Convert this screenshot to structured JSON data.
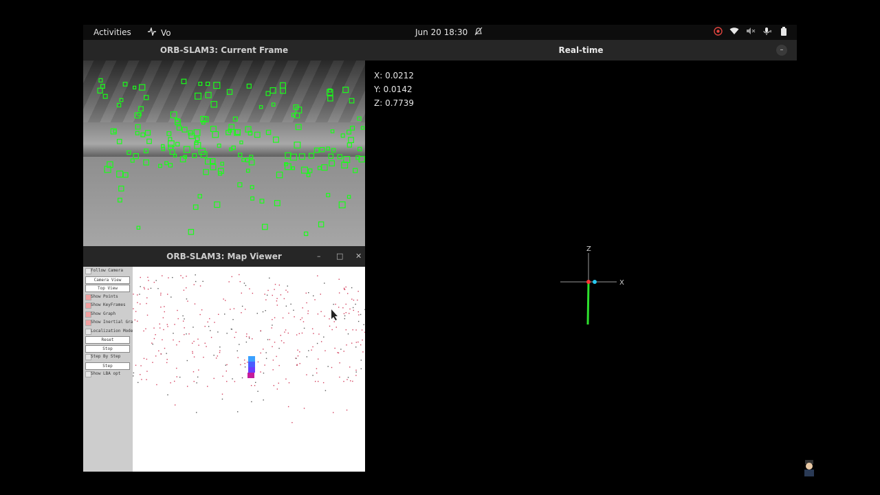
{
  "topbar": {
    "activities": "Activities",
    "app_name": "Vo",
    "clock": "Jun 20  18:30"
  },
  "current_frame": {
    "title": "ORB-SLAM3: Current Frame"
  },
  "map_viewer": {
    "title": "ORB-SLAM3: Map Viewer",
    "minimize": "–",
    "maximize": "□",
    "close": "✕",
    "panel": [
      {
        "type": "check",
        "label": "Follow Camera",
        "checked": false
      },
      {
        "type": "button",
        "label": "Camera View"
      },
      {
        "type": "button",
        "label": "Top View"
      },
      {
        "type": "check",
        "label": "Show Points",
        "checked": true
      },
      {
        "type": "check",
        "label": "Show KeyFrames",
        "checked": true
      },
      {
        "type": "check",
        "label": "Show Graph",
        "checked": true
      },
      {
        "type": "check",
        "label": "Show Inertial Graph",
        "checked": true
      },
      {
        "type": "check",
        "label": "Localization Mode",
        "checked": false
      },
      {
        "type": "button",
        "label": "Reset"
      },
      {
        "type": "button",
        "label": "Stop"
      },
      {
        "type": "check",
        "label": "Step By Step",
        "checked": false
      },
      {
        "type": "button",
        "label": "Step"
      },
      {
        "type": "check",
        "label": "Show LBA opt",
        "checked": false
      }
    ]
  },
  "realtime": {
    "title": "Real-time",
    "minimize": "–",
    "x_line": "X:  0.0212",
    "y_line": "Y:  0.0142",
    "z_line": "Z:  0.7739",
    "axis_z": "Z",
    "axis_x": "X"
  },
  "colors": {
    "feature": "#19ff19",
    "map_point": "#d23c5a",
    "accent_red": "#e0443e"
  }
}
